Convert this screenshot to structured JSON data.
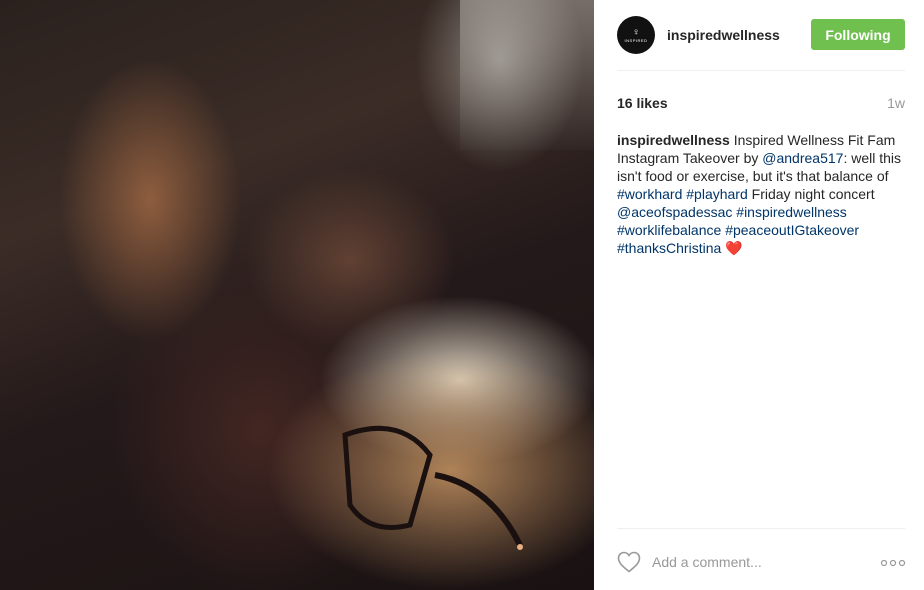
{
  "post": {
    "username": "inspiredwellness",
    "avatar_text": "INSPIRED",
    "follow_label": "Following",
    "likes": "16 likes",
    "time": "1w",
    "caption": {
      "user": "inspiredwellness",
      "t1": " Inspired Wellness Fit Fam Instagram Takeover by ",
      "mention1": "@andrea517",
      "t2": ": well this isn't food or exercise, but it's that balance of ",
      "tag1": "#workhard",
      "t3": " ",
      "tag2": "#playhard",
      "t4": " Friday night concert ",
      "mention2": "@aceofspadessac",
      "t5": " ",
      "tag3": "#inspiredwellness",
      "t6": " ",
      "tag4": "#worklifebalance",
      "t7": " ",
      "tag5": "#peaceoutIGtakeover",
      "t8": " ",
      "tag6": "#thanksChristina",
      "t9": " ",
      "emoji": "❤️"
    },
    "comment_placeholder": "Add a comment..."
  },
  "icons": {
    "like": "heart-outline-icon",
    "more": "more-options-icon"
  },
  "colors": {
    "follow_button": "#70c050",
    "link": "#003569",
    "muted": "#999999"
  }
}
